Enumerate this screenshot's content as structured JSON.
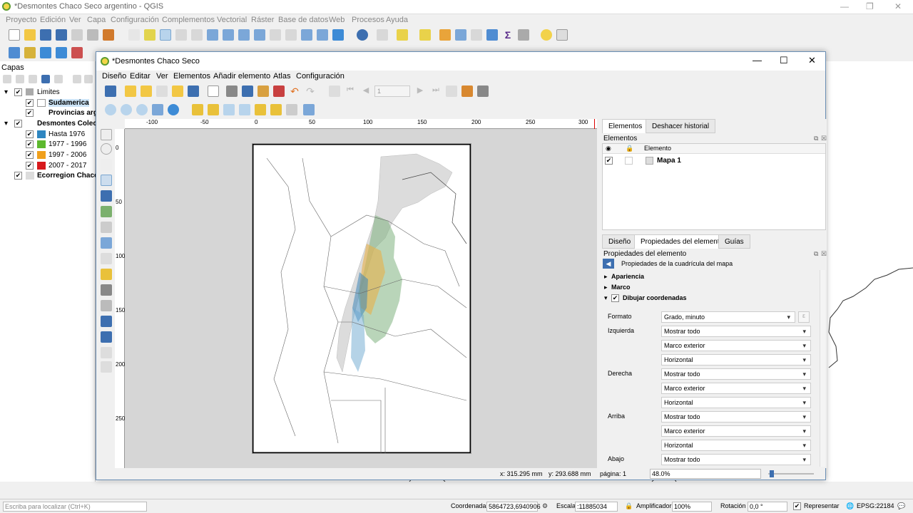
{
  "app": {
    "title": "*Desmontes Chaco Seco argentino - QGIS",
    "menu": [
      "Proyecto",
      "Edición",
      "Ver",
      "Capa",
      "Configuración",
      "Complementos",
      "Vectorial",
      "Ráster",
      "Base de datos",
      "Web",
      "Procesos",
      "Ayuda"
    ]
  },
  "layers_panel": {
    "title": "Capas",
    "items": [
      {
        "label": "Limites"
      },
      {
        "label": "Sudamerica"
      },
      {
        "label": "Provincias arg"
      },
      {
        "label": "Desmontes Colec"
      },
      {
        "label": "Hasta 1976",
        "color": "#2e86c1"
      },
      {
        "label": "1977 - 1996",
        "color": "#5cb82e"
      },
      {
        "label": "1997 - 2006",
        "color": "#f0a01c"
      },
      {
        "label": "2007 - 2017",
        "color": "#d7191c"
      },
      {
        "label": "Ecorregion Chaco",
        "color": "#dcdcdc"
      }
    ]
  },
  "composer": {
    "title": "*Desmontes Chaco Seco",
    "menu": [
      "Diseño",
      "Editar",
      "Ver",
      "Elementos",
      "Añadir elemento",
      "Atlas",
      "Configuración"
    ],
    "page_number": "1",
    "ruler_h": [
      "-100",
      "-50",
      "0",
      "50",
      "100",
      "150",
      "200",
      "250",
      "300"
    ],
    "ruler_v": [
      "0",
      "50",
      "100",
      "150",
      "200",
      "250"
    ],
    "items_panel": {
      "tabs": [
        "Elementos",
        "Deshacer historial"
      ],
      "header": "Elementos",
      "column": "Elemento",
      "items": [
        {
          "name": "Mapa 1"
        }
      ]
    },
    "props_panel": {
      "tabs": [
        "Diseño",
        "Propiedades del elemento",
        "Guías"
      ],
      "header": "Propiedades del elemento",
      "subtitle": "Propiedades de la cuadrícula del mapa",
      "sections": [
        "Apariencia",
        "Marco",
        "Dibujar coordenadas"
      ],
      "formato_label": "Formato",
      "formato_value": "Grado, minuto",
      "sides": [
        {
          "label": "Izquierda",
          "values": [
            "Mostrar todo",
            "Marco exterior",
            "Horizontal"
          ]
        },
        {
          "label": "Derecha",
          "values": [
            "Mostrar todo",
            "Marco exterior",
            "Horizontal"
          ]
        },
        {
          "label": "Arriba",
          "values": [
            "Mostrar todo",
            "Marco exterior",
            "Horizontal"
          ]
        },
        {
          "label": "Abajo",
          "values": [
            "Mostrar todo"
          ]
        }
      ]
    },
    "status": {
      "x": "x: 315.295 mm",
      "y": "y: 293.688 mm",
      "page": "página: 1",
      "zoom": "48.0%"
    }
  },
  "statusbar": {
    "search_placeholder": "Escriba para localizar (Ctrl+K)",
    "coord_label": "Coordenada",
    "coord_value": "5864723,6940906",
    "scale_label": "Escala",
    "scale_value": ":11885034",
    "magnifier_label": "Amplificador",
    "magnifier_value": "100%",
    "rotation_label": "Rotación",
    "rotation_value": "0,0 °",
    "render_label": "Representar",
    "crs": "EPSG:22184"
  }
}
